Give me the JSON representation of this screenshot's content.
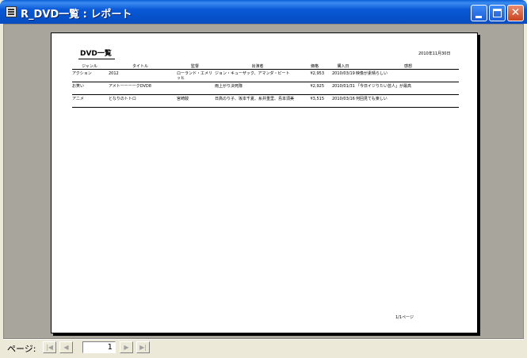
{
  "window": {
    "title": "R_DVD一覧 : レポート"
  },
  "report": {
    "title": "DVD一覧",
    "date": "2010年11月30日",
    "columns": [
      "ジャンル",
      "タイトル",
      "監督",
      "出演者",
      "価格",
      "購入日",
      "感想"
    ],
    "rows": [
      [
        "アクション",
        "2012",
        "ローランド・エメリッヒ",
        "ジョン・キューザック、アマンダ・ピート",
        "¥2,953",
        "2010/03/19",
        "映像が素晴らしい"
      ],
      [
        "お笑い",
        "アメトーーーークDVD8",
        "",
        "雨上がり決死隊",
        "¥2,925",
        "2010/01/31",
        "「今日イジりたい芸人」が最高"
      ],
      [
        "アニメ",
        "となりのトトロ",
        "宮崎駿",
        "日高のり子、坂本千夏、糸井重里、島本須美",
        "¥3,515",
        "2010/03/16",
        "何回見ても楽しい"
      ]
    ],
    "page_number": "1/1ページ"
  },
  "nav": {
    "label": "ページ:",
    "page": "1"
  }
}
